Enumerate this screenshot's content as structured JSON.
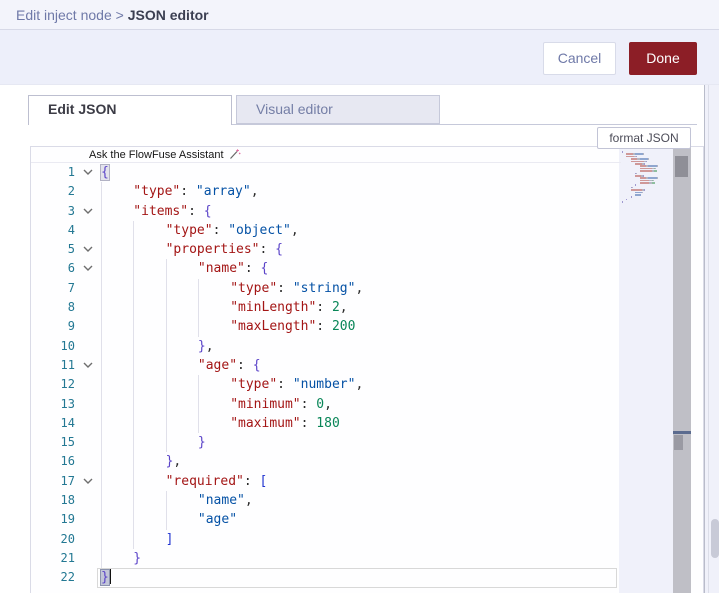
{
  "breadcrumb": {
    "parent": "Edit inject node",
    "separator": " > ",
    "current": "JSON editor"
  },
  "actions": {
    "cancel_label": "Cancel",
    "done_label": "Done"
  },
  "tabs": [
    {
      "label": "Edit JSON",
      "active": true
    },
    {
      "label": "Visual editor",
      "active": false
    }
  ],
  "format_button": {
    "label": "format JSON"
  },
  "assistant": {
    "label": "Ask the FlowFuse Assistant",
    "icon": "wand-sparkle-icon"
  },
  "colors": {
    "done_button": "#8C1E26",
    "json_key": "#A31515",
    "json_string": "#0451A5",
    "json_number": "#098658",
    "line_number": "#237893",
    "header_bg": "#F3F4FB",
    "tab_inactive_bg": "#E7E8F2"
  },
  "editor": {
    "language": "json",
    "cursor_line": 22,
    "lines": [
      {
        "n": 1,
        "fold": true,
        "ind": 0,
        "tok": [
          [
            "{",
            "brc",
            "m-open"
          ]
        ]
      },
      {
        "n": 2,
        "fold": false,
        "ind": 1,
        "tok": [
          [
            "\"type\"",
            "key"
          ],
          [
            ": ",
            "pun"
          ],
          [
            "\"array\"",
            "str"
          ],
          [
            ",",
            "pun"
          ]
        ]
      },
      {
        "n": 3,
        "fold": true,
        "ind": 1,
        "tok": [
          [
            "\"items\"",
            "key"
          ],
          [
            ": ",
            "pun"
          ],
          [
            "{",
            "brc"
          ]
        ]
      },
      {
        "n": 4,
        "fold": false,
        "ind": 2,
        "tok": [
          [
            "\"type\"",
            "key"
          ],
          [
            ": ",
            "pun"
          ],
          [
            "\"object\"",
            "str"
          ],
          [
            ",",
            "pun"
          ]
        ]
      },
      {
        "n": 5,
        "fold": true,
        "ind": 2,
        "tok": [
          [
            "\"properties\"",
            "key"
          ],
          [
            ": ",
            "pun"
          ],
          [
            "{",
            "brc"
          ]
        ]
      },
      {
        "n": 6,
        "fold": true,
        "ind": 3,
        "tok": [
          [
            "\"name\"",
            "key"
          ],
          [
            ": ",
            "pun"
          ],
          [
            "{",
            "brc"
          ]
        ]
      },
      {
        "n": 7,
        "fold": false,
        "ind": 4,
        "tok": [
          [
            "\"type\"",
            "key"
          ],
          [
            ": ",
            "pun"
          ],
          [
            "\"string\"",
            "str"
          ],
          [
            ",",
            "pun"
          ]
        ]
      },
      {
        "n": 8,
        "fold": false,
        "ind": 4,
        "tok": [
          [
            "\"minLength\"",
            "key"
          ],
          [
            ": ",
            "pun"
          ],
          [
            "2",
            "num"
          ],
          [
            ",",
            "pun"
          ]
        ]
      },
      {
        "n": 9,
        "fold": false,
        "ind": 4,
        "tok": [
          [
            "\"maxLength\"",
            "key"
          ],
          [
            ": ",
            "pun"
          ],
          [
            "200",
            "num"
          ]
        ]
      },
      {
        "n": 10,
        "fold": false,
        "ind": 3,
        "tok": [
          [
            "}",
            "brc"
          ],
          [
            ",",
            "pun"
          ]
        ]
      },
      {
        "n": 11,
        "fold": true,
        "ind": 3,
        "tok": [
          [
            "\"age\"",
            "key"
          ],
          [
            ": ",
            "pun"
          ],
          [
            "{",
            "brc"
          ]
        ]
      },
      {
        "n": 12,
        "fold": false,
        "ind": 4,
        "tok": [
          [
            "\"type\"",
            "key"
          ],
          [
            ": ",
            "pun"
          ],
          [
            "\"number\"",
            "str"
          ],
          [
            ",",
            "pun"
          ]
        ]
      },
      {
        "n": 13,
        "fold": false,
        "ind": 4,
        "tok": [
          [
            "\"minimum\"",
            "key"
          ],
          [
            ": ",
            "pun"
          ],
          [
            "0",
            "num"
          ],
          [
            ",",
            "pun"
          ]
        ]
      },
      {
        "n": 14,
        "fold": false,
        "ind": 4,
        "tok": [
          [
            "\"maximum\"",
            "key"
          ],
          [
            ": ",
            "pun"
          ],
          [
            "180",
            "num"
          ]
        ]
      },
      {
        "n": 15,
        "fold": false,
        "ind": 3,
        "tok": [
          [
            "}",
            "brc"
          ]
        ]
      },
      {
        "n": 16,
        "fold": false,
        "ind": 2,
        "tok": [
          [
            "}",
            "brc"
          ],
          [
            ",",
            "pun"
          ]
        ]
      },
      {
        "n": 17,
        "fold": true,
        "ind": 2,
        "tok": [
          [
            "\"required\"",
            "key"
          ],
          [
            ": ",
            "pun"
          ],
          [
            "[",
            "brk"
          ]
        ]
      },
      {
        "n": 18,
        "fold": false,
        "ind": 3,
        "tok": [
          [
            "\"name\"",
            "str"
          ],
          [
            ",",
            "pun"
          ]
        ]
      },
      {
        "n": 19,
        "fold": false,
        "ind": 3,
        "tok": [
          [
            "\"age\"",
            "str"
          ]
        ]
      },
      {
        "n": 20,
        "fold": false,
        "ind": 2,
        "tok": [
          [
            "]",
            "brk"
          ]
        ]
      },
      {
        "n": 21,
        "fold": false,
        "ind": 1,
        "tok": [
          [
            "}",
            "brc"
          ]
        ]
      },
      {
        "n": 22,
        "fold": false,
        "ind": 0,
        "tok": [
          [
            "}",
            "brc",
            "m-close"
          ]
        ]
      }
    ]
  }
}
